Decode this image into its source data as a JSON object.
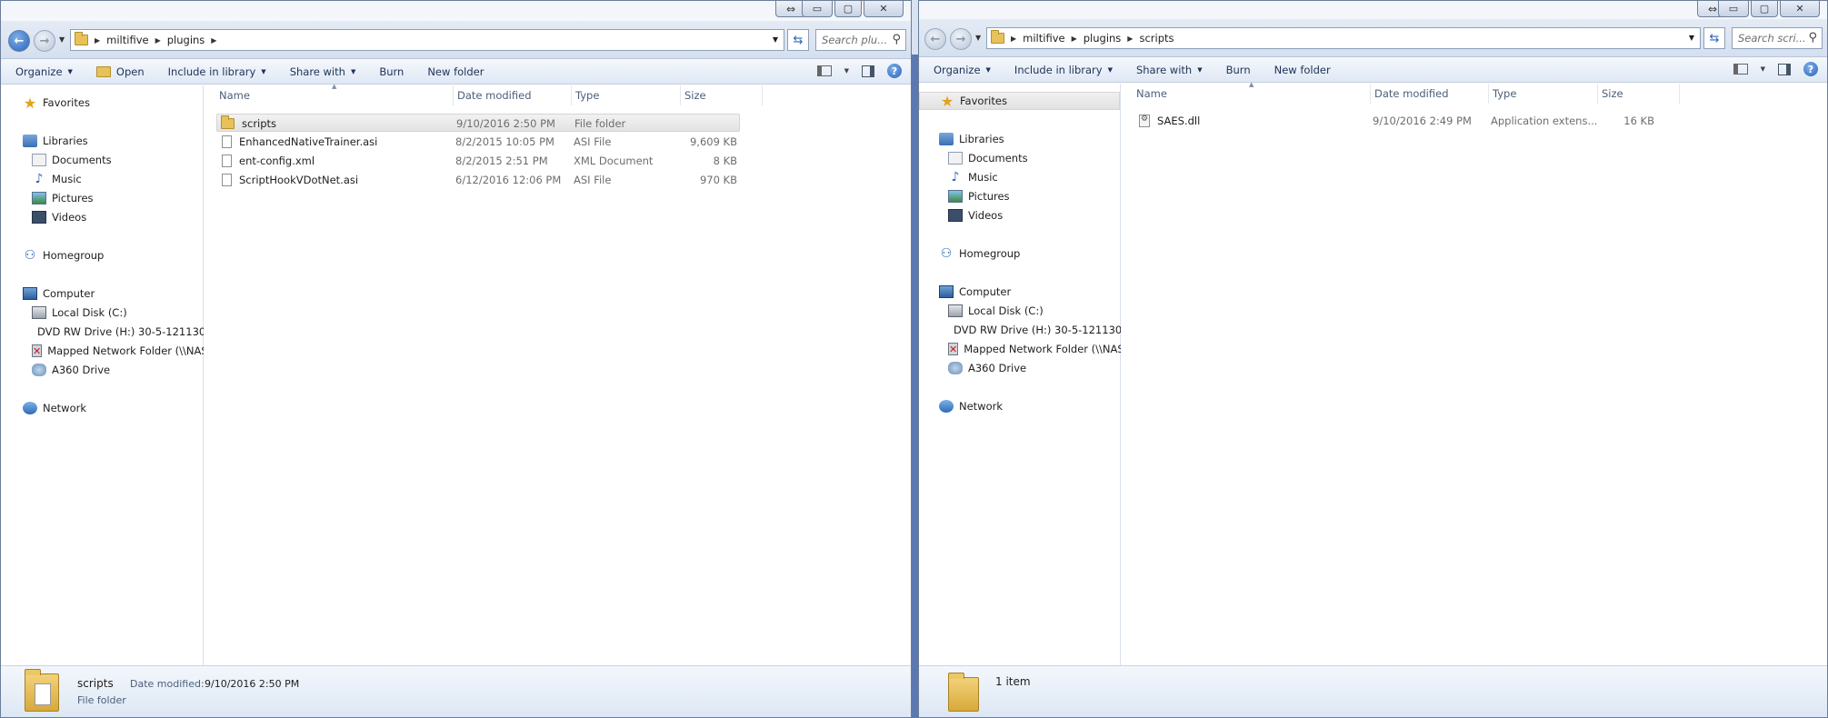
{
  "left_window": {
    "address": {
      "segments": [
        "miltifive",
        "plugins"
      ]
    },
    "search": {
      "placeholder": "Search plu..."
    },
    "toolbar": {
      "organize": "Organize",
      "open": "Open",
      "include": "Include in library",
      "share": "Share with",
      "burn": "Burn",
      "new_folder": "New folder"
    },
    "nav": {
      "favorites": "Favorites",
      "libraries": "Libraries",
      "documents": "Documents",
      "music": "Music",
      "pictures": "Pictures",
      "videos": "Videos",
      "homegroup": "Homegroup",
      "computer": "Computer",
      "local_disk": "Local Disk (C:)",
      "dvd": "DVD RW Drive (H:) 30-5-121130",
      "mapped": "Mapped Network Folder (\\\\NAS",
      "a360": "A360 Drive",
      "network": "Network"
    },
    "columns": {
      "name": "Name",
      "date": "Date modified",
      "type": "Type",
      "size": "Size"
    },
    "files": [
      {
        "name": "scripts",
        "date": "9/10/2016 2:50 PM",
        "type": "File folder",
        "size": "",
        "icon": "folder-icon"
      },
      {
        "name": "EnhancedNativeTrainer.asi",
        "date": "8/2/2015 10:05 PM",
        "type": "ASI File",
        "size": "9,609 KB",
        "icon": "file-icon"
      },
      {
        "name": "ent-config.xml",
        "date": "8/2/2015 2:51 PM",
        "type": "XML Document",
        "size": "8 KB",
        "icon": "file-icon"
      },
      {
        "name": "ScriptHookVDotNet.asi",
        "date": "6/12/2016 12:06 PM",
        "type": "ASI File",
        "size": "970 KB",
        "icon": "file-icon"
      }
    ],
    "details": {
      "name": "scripts",
      "date_label": "Date modified:",
      "date_value": "9/10/2016 2:50 PM",
      "type": "File folder"
    }
  },
  "right_window": {
    "address": {
      "segments": [
        "miltifive",
        "plugins",
        "scripts"
      ]
    },
    "search": {
      "placeholder": "Search scri..."
    },
    "toolbar": {
      "organize": "Organize",
      "include": "Include in library",
      "share": "Share with",
      "burn": "Burn",
      "new_folder": "New folder"
    },
    "nav": {
      "favorites": "Favorites",
      "libraries": "Libraries",
      "documents": "Documents",
      "music": "Music",
      "pictures": "Pictures",
      "videos": "Videos",
      "homegroup": "Homegroup",
      "computer": "Computer",
      "local_disk": "Local Disk (C:)",
      "dvd": "DVD RW Drive (H:) 30-5-121130",
      "mapped": "Mapped Network Folder (\\\\NAS",
      "a360": "A360 Drive",
      "network": "Network"
    },
    "columns": {
      "name": "Name",
      "date": "Date modified",
      "type": "Type",
      "size": "Size"
    },
    "files": [
      {
        "name": "SAES.dll",
        "date": "9/10/2016 2:49 PM",
        "type": "Application extens...",
        "size": "16 KB",
        "icon": "dll-icon"
      }
    ],
    "details": {
      "count": "1 item"
    }
  }
}
